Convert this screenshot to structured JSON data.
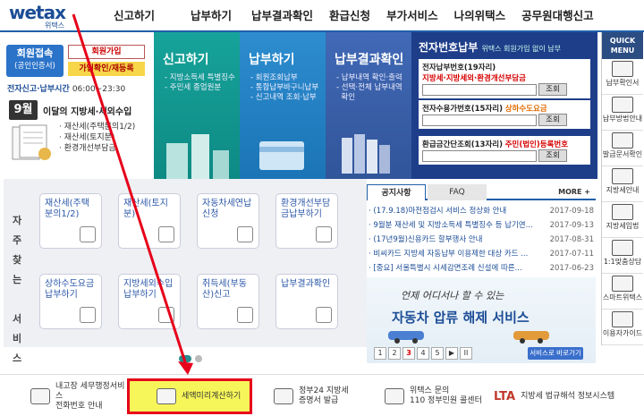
{
  "logo": {
    "text": "wetax",
    "sub": "위택스"
  },
  "nav": [
    "신고하기",
    "납부하기",
    "납부결과확인",
    "환급신청",
    "부가서비스",
    "나의위택스",
    "공무원대행신고"
  ],
  "login": {
    "login_label": "회원접속",
    "login_sub": "(공인인증서)",
    "join_label": "회원가입",
    "confirm_label": "가입확인/재등록",
    "hours_label": "전자신고·납부시간",
    "hours_value": "06:00~23:30",
    "month": "9월",
    "month_title": "이달의 지방세·세외수입",
    "tax_items": [
      "재산세(주택분의1/2)",
      "재산세(토지분)",
      "환경개선부담금"
    ]
  },
  "banner": {
    "report_title": "신고하기",
    "report_items": [
      "지방소득세 특별징수",
      "주민세 종업원분"
    ],
    "pay_title": "납부하기",
    "pay_items": [
      "회원조회납부",
      "통합납부바구니납부",
      "신고내역 조회·납부"
    ],
    "result_title": "납부결과확인",
    "result_items": [
      "납부내역 확인·출력",
      "선택·전체 납부내역",
      "확인"
    ],
    "epay_title": "전자번호납부",
    "epay_sub": "위택스 회원가입 없이 납부",
    "epay_num_label": "전자납부번호(19자리)",
    "epay_num_desc": "지방세·지방세외·환경개선부담금",
    "water_label": "전자수용가번호(15자리)",
    "water_desc": "상하수도요금",
    "simple_label": "환급금간단조회(13자리)",
    "simple_desc": "주민(법인)등록번호",
    "query_btn": "조회"
  },
  "quick": {
    "head": "QUICK MENU",
    "items": [
      "납부확인서",
      "납부방법안내",
      "발급문서확인",
      "지방세안내",
      "지방세입법",
      "1:1맞춤상담",
      "스마트위택스",
      "이용자가이드"
    ]
  },
  "service": {
    "label": [
      "자",
      "주",
      "찾",
      "는",
      "서",
      "비",
      "스"
    ],
    "cards": [
      "재산세(주택분의1/2)",
      "재산세(토지분)",
      "자동차세연납신청",
      "환경개선부담금납부하기",
      "상하수도요금납부하기",
      "지방세외수입납부하기",
      "취득세(부동산)신고",
      "납부결과확인"
    ]
  },
  "notice": {
    "tab_notice": "공지사항",
    "tab_faq": "FAQ",
    "more": "MORE +",
    "items": [
      {
        "title": "(17.9.18)마전점검시 서비스 정상화 안내",
        "date": "2017-09-18"
      },
      {
        "title": "9월분 재산세 및 지방소득세 특별징수 등 납기연...",
        "date": "2017-09-13"
      },
      {
        "title": "(17년9월)신용카드 할부행사 안내",
        "date": "2017-08-31"
      },
      {
        "title": "비씨카드 지방세 자동납부 이용제한 대상 카드 ...",
        "date": "2017-07-11"
      },
      {
        "title": "[중요] 서울특별시 시세감면조례 신설에 따른...",
        "date": "2017-06-23"
      }
    ]
  },
  "car": {
    "sub": "언제 어디서나 할 수 있는",
    "title": "자동차 압류 해제 서비스",
    "btn": "서비스로 바로가기",
    "pages": [
      "1",
      "2",
      "3",
      "4",
      "5",
      "▶",
      "II"
    ]
  },
  "bottom": [
    {
      "label": "내고장 세무행정서비스\n전화번호 안내"
    },
    {
      "label": "세액미리계산하기"
    },
    {
      "label": "정부24 지방세\n증명서 발급"
    },
    {
      "label": "위택스 문의\n110 정부민원 콜센터"
    },
    {
      "label": "지방세 법규해석 정보시스템"
    }
  ],
  "colors": {
    "accent": "#1f5fa8",
    "highlight_border": "#e6001a",
    "arrow": "#e6001a"
  }
}
